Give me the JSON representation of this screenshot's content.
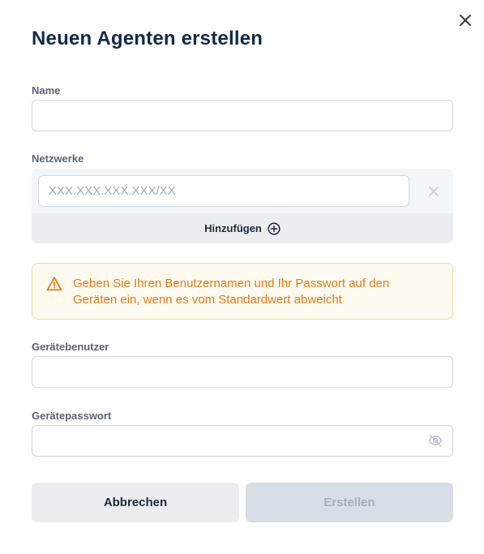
{
  "dialog": {
    "title": "Neuen Agenten erstellen",
    "close_icon": "close-icon"
  },
  "name_field": {
    "label": "Name",
    "value": "",
    "placeholder": ""
  },
  "networks": {
    "label": "Netzwerke",
    "items": [
      {
        "value": "",
        "placeholder": "XXX.XXX.XXX.XXX/XX",
        "remove_icon": "close-icon"
      }
    ],
    "add_label": "Hinzufügen",
    "add_icon": "plus-circle-icon"
  },
  "warning": {
    "icon": "warning-triangle-icon",
    "text": "Geben Sie Ihren Benutzernamen und Ihr Passwort auf den Geräten ein, wenn es vom Standardwert abweicht",
    "color": "#e07b1a"
  },
  "device_user": {
    "label": "Gerätebenutzer",
    "value": "",
    "placeholder": ""
  },
  "device_password": {
    "label": "Gerätepasswort",
    "value": "",
    "placeholder": "",
    "toggle_icon": "eye-off-icon"
  },
  "buttons": {
    "cancel_label": "Abbrechen",
    "create_label": "Erstellen",
    "create_disabled": true
  },
  "colors": {
    "title": "#132a4a",
    "label": "#5a6478",
    "warning_bg": "#fffaf0",
    "warning_border": "#f6d99c"
  }
}
